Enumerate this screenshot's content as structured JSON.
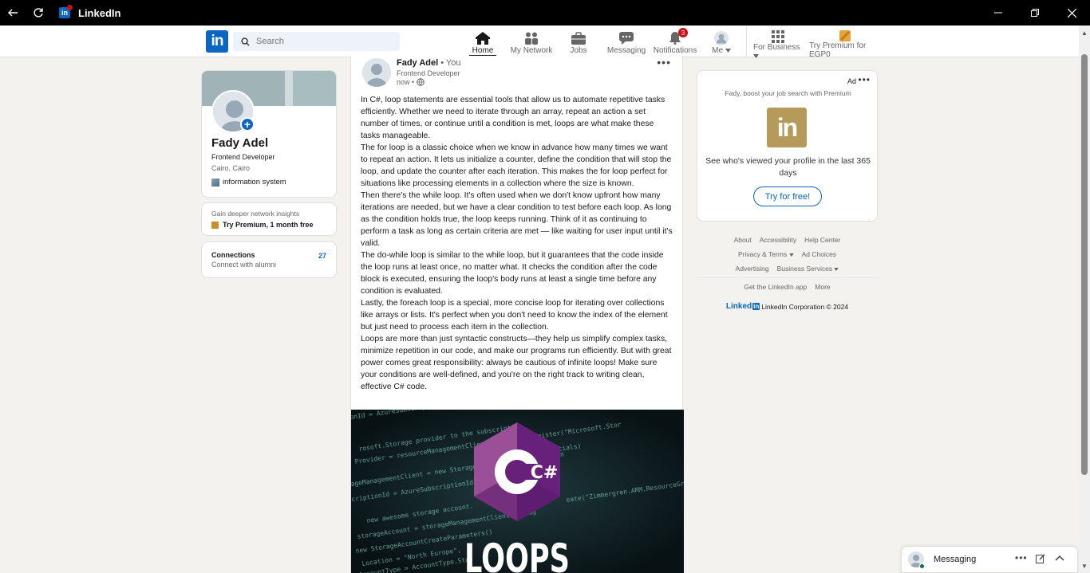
{
  "window": {
    "title": "LinkedIn",
    "back_icon": "back-arrow-icon",
    "refresh_icon": "refresh-icon"
  },
  "nav": {
    "logo_text": "in",
    "search_placeholder": "Search",
    "items": [
      {
        "label": "Home",
        "icon": "home-icon",
        "active": true
      },
      {
        "label": "My Network",
        "icon": "network-icon"
      },
      {
        "label": "Jobs",
        "icon": "jobs-icon"
      },
      {
        "label": "Messaging",
        "icon": "messaging-icon"
      },
      {
        "label": "Notifications",
        "icon": "bell-icon",
        "badge": "3"
      },
      {
        "label": "Me",
        "icon": "avatar-icon"
      },
      {
        "label": "For Business",
        "icon": "grid-icon"
      },
      {
        "label": "Try Premium for EGP0",
        "icon": "premium-icon"
      }
    ]
  },
  "profile": {
    "name": "Fady Adel",
    "headline": "Frontend Developer",
    "location": "Cairo, Cairo",
    "organization": "information system"
  },
  "premium_promo": {
    "line1": "Gain deeper network insights",
    "line2": "Try Premium, 1 month free"
  },
  "connections": {
    "title": "Connections",
    "subtitle": "Connect with alumni",
    "count": "27"
  },
  "post": {
    "author": "Fady Adel",
    "you": " • You",
    "headline": "Frontend Developer",
    "time": "now •",
    "paragraphs": [
      "In C#, loop statements are essential tools that allow us to automate repetitive tasks efficiently. Whether we need to iterate through an array, repeat an action a set number of times, or continue until a condition is met, loops are what make these tasks manageable.",
      "The for loop is a classic choice when we know in advance how many times we want to repeat an action. It lets us initialize a counter, define the condition that will stop the loop, and update the counter after each iteration. This makes the for loop perfect for situations like processing elements in a collection where the size is known.",
      "Then there's the while loop. It's often used when we don't know upfront how many iterations are needed, but we have a clear condition to test before each loop. As long as the condition holds true, the loop keeps running. Think of it as continuing to perform a task as long as certain criteria are met — like waiting for user input until it's valid.",
      "The do-while loop is similar to the while loop, but it guarantees that the code inside the loop runs at least once, no matter what. It checks the condition after the code block is executed, ensuring the loop's body runs at least a single time before any condition is evaluated.",
      "Lastly, the foreach loop is a special, more concise loop for iterating over collections like arrays or lists. It's perfect when you don't need to know the index of the element but just need to process each item in the collection.",
      "Loops are more than just syntactic constructs—they help us simplify complex tasks, minimize repetition in our code, and make our programs run efficiently. But with great power comes great responsibility: always be cautious of infinite loops! Make sure your conditions are well-defined, and you're on the right track to writing clean, effective C# code."
    ],
    "image_title": "LOOPS",
    "image_logo": "C#",
    "image_code_lines": [
      "ionId = AzureSubscriptionId",
      "rosoft.Storage provider to the subscription.",
      "Provider = resourceManagementClient.Providers.Register(\"Microsoft.Stor",
      "tials)",
      "ageManagementClient = new StorageManagementClient(creden",
      "scriptionId = AzureSubscriptionId",
      "eate(\"Zimmergren.ARM.ResourceGroupDemo-",
      "new awesome storage account.",
      "storageAccount = storageManagementClient.Storag",
      "new StorageAccountCreateParameters()",
      "Location = \"North Europe\",",
      "AccountType = AccountType.Sta"
    ]
  },
  "ad": {
    "label": "Ad",
    "subtitle": "Fady, boost your job search with Premium",
    "logo_text": "in",
    "text": "See who's viewed your profile in the last 365 days",
    "button": "Try for free!"
  },
  "footer": {
    "row1": [
      "About",
      "Accessibility",
      "Help Center"
    ],
    "privacy": "Privacy & Terms",
    "ad_choices": "Ad Choices",
    "advertising": "Advertising",
    "business_services": "Business Services",
    "get_app": "Get the LinkedIn app",
    "more": "More",
    "brand": "Linked",
    "brand_in": "in",
    "copyright": "LinkedIn Corporation © 2024"
  },
  "messaging": {
    "label": "Messaging"
  },
  "colors": {
    "brand": "#0a66c2",
    "background": "#f4f2ee",
    "badge": "#cc1016",
    "premium_gold": "#b69a5a",
    "csharp_purple": "#68217a"
  }
}
